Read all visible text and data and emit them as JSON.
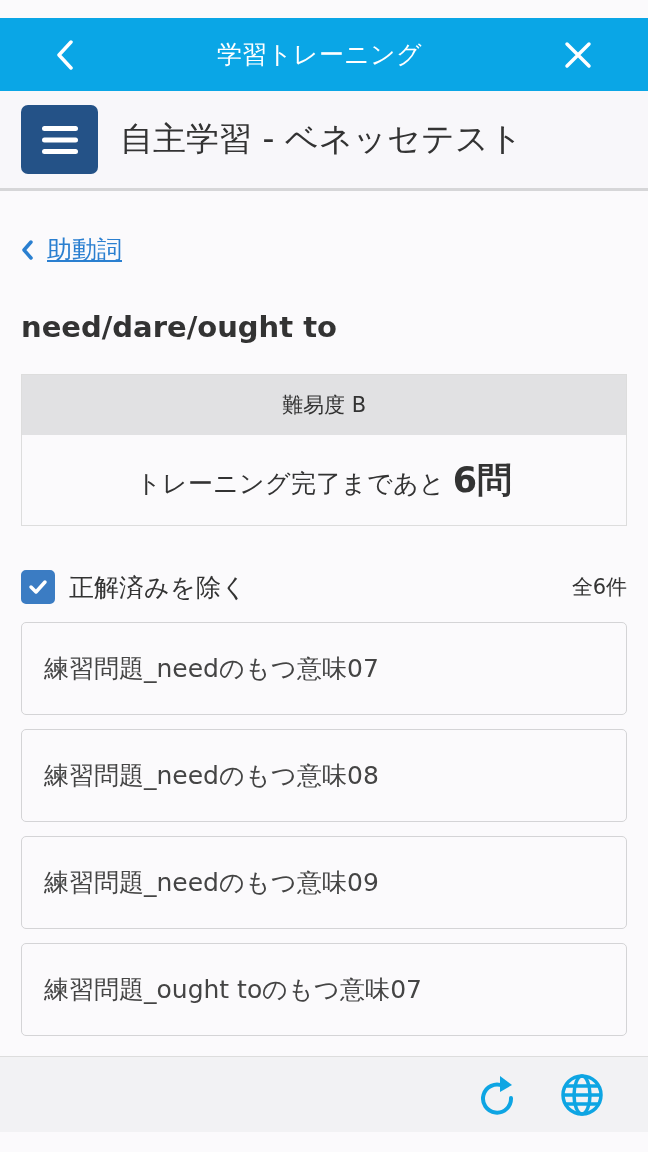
{
  "nav_bar": {
    "title": "学習トレーニング"
  },
  "header": {
    "title": "自主学習 - ベネッセテスト"
  },
  "breadcrumb": {
    "label": "助動詞"
  },
  "page_title": "need/dare/ought to",
  "difficulty_card": {
    "heading": "難易度 B",
    "remaining": "トレーニング完了まであと **6問**"
  },
  "filter": {
    "label": "正解済みを除く",
    "checked": true,
    "count": "全6件"
  },
  "questions": [
    {
      "title": "練習問題_needのもつ意味07"
    },
    {
      "title": "練習問題_needのもつ意味08"
    },
    {
      "title": "練習問題_needのもつ意味09"
    },
    {
      "title": "練習問題_ought toのもつ意味07"
    }
  ]
}
